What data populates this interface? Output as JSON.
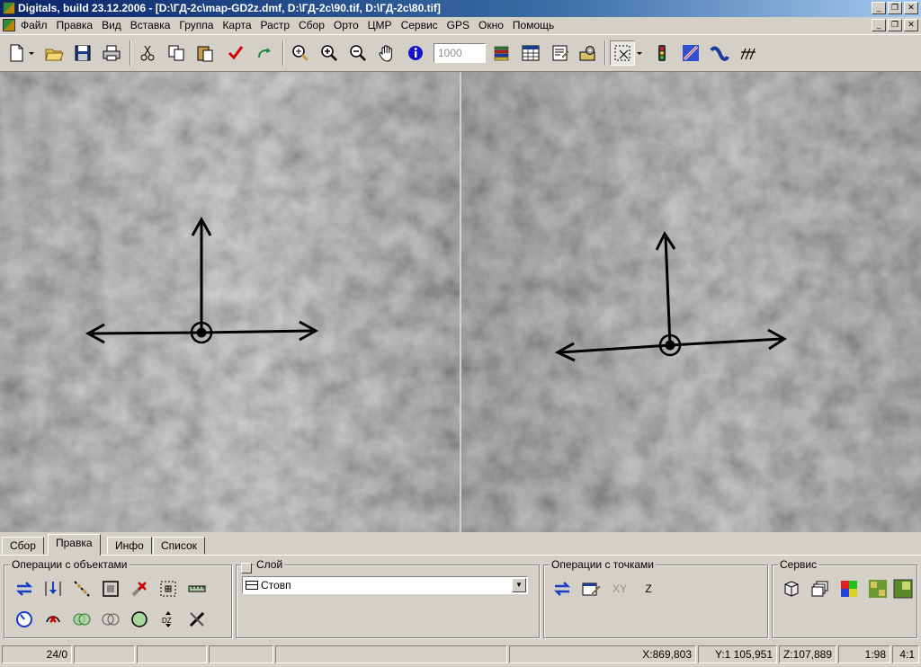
{
  "title_bar": {
    "title": "Digitals, build 23.12.2006 - [D:\\ГД-2с\\map-GD2z.dmf, D:\\ГД-2с\\90.tif, D:\\ГД-2с\\80.tif]",
    "minimize": "_",
    "restore": "❐",
    "close": "✕"
  },
  "menu": {
    "items": [
      "Файл",
      "Правка",
      "Вид",
      "Вставка",
      "Группа",
      "Карта",
      "Растр",
      "Сбор",
      "Орто",
      "ЦМР",
      "Сервис",
      "GPS",
      "Окно",
      "Помощь"
    ],
    "minimize": "_",
    "restore": "❐",
    "close": "✕"
  },
  "toolbar": {
    "scale_value": "1000",
    "buttons": [
      "new-file-icon",
      "open-folder-icon",
      "save-icon",
      "print-icon",
      "cut-icon",
      "copy-icon",
      "paste-icon",
      "check-icon",
      "redo-icon",
      "zoom-region-icon",
      "zoom-in-icon",
      "zoom-out-icon",
      "pan-hand-icon",
      "info-icon",
      "layers-icon",
      "table-icon",
      "properties-icon",
      "settings-icon",
      "select-tool-icon",
      "traffic-light-icon",
      "draw-icon",
      "curve-icon",
      "hatch-icon"
    ]
  },
  "viewports": {
    "left_label": "left-stereo-image",
    "right_label": "right-stereo-image"
  },
  "tabs": [
    "Сбор",
    "Правка",
    "Инфо",
    "Список"
  ],
  "active_tab": "Правка",
  "panel": {
    "objects_group": {
      "label": "Операции с объектами"
    },
    "layer_group": {
      "label": "Слой",
      "value": "Стовп"
    },
    "points_group": {
      "label": "Операции с точками",
      "xy_label": "XY",
      "z_label": "Z"
    },
    "service_group": {
      "label": "Сервис"
    }
  },
  "status": {
    "counter": "24/0",
    "x": "X:869,803",
    "y": "Y:1 105,951",
    "z": "Z:107,889",
    "scale": "1:98",
    "ratio": "4:1"
  },
  "colors": {
    "title_start": "#0a246a",
    "title_end": "#a6caf0",
    "chrome": "#d4d0c8",
    "accent_blue": "#0000cc"
  }
}
